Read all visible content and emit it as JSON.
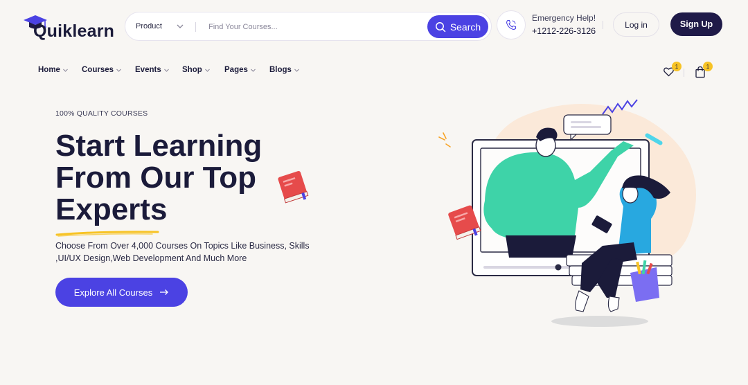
{
  "brand": {
    "name": "Quiklearn",
    "color": "#4b42e3",
    "dark": "#1f1a48"
  },
  "search": {
    "category": "Product",
    "placeholder": "Find Your Courses...",
    "button_label": "Search"
  },
  "contact": {
    "title": "Emergency Help!",
    "phone": "+1212-226-3126",
    "icon": "phone-icon"
  },
  "auth": {
    "login_label": "Log in",
    "signup_label": "Sign Up"
  },
  "nav": {
    "items": [
      {
        "label": "Home"
      },
      {
        "label": "Courses"
      },
      {
        "label": "Events"
      },
      {
        "label": "Shop"
      },
      {
        "label": "Pages"
      },
      {
        "label": "Blogs"
      }
    ]
  },
  "header_icons": {
    "wishlist_count": "1",
    "cart_count": "1",
    "badge_color": "#f7c325"
  },
  "hero": {
    "tag": "100% QUALITY COURSES",
    "title_lines": [
      "Start Learning",
      "From Our Top",
      "Experts"
    ],
    "description": "Choose From Over 4,000 Courses On Topics Like Business, Skills ,UI/UX Design,Web Development And Much More",
    "cta_label": "Explore All Courses"
  }
}
